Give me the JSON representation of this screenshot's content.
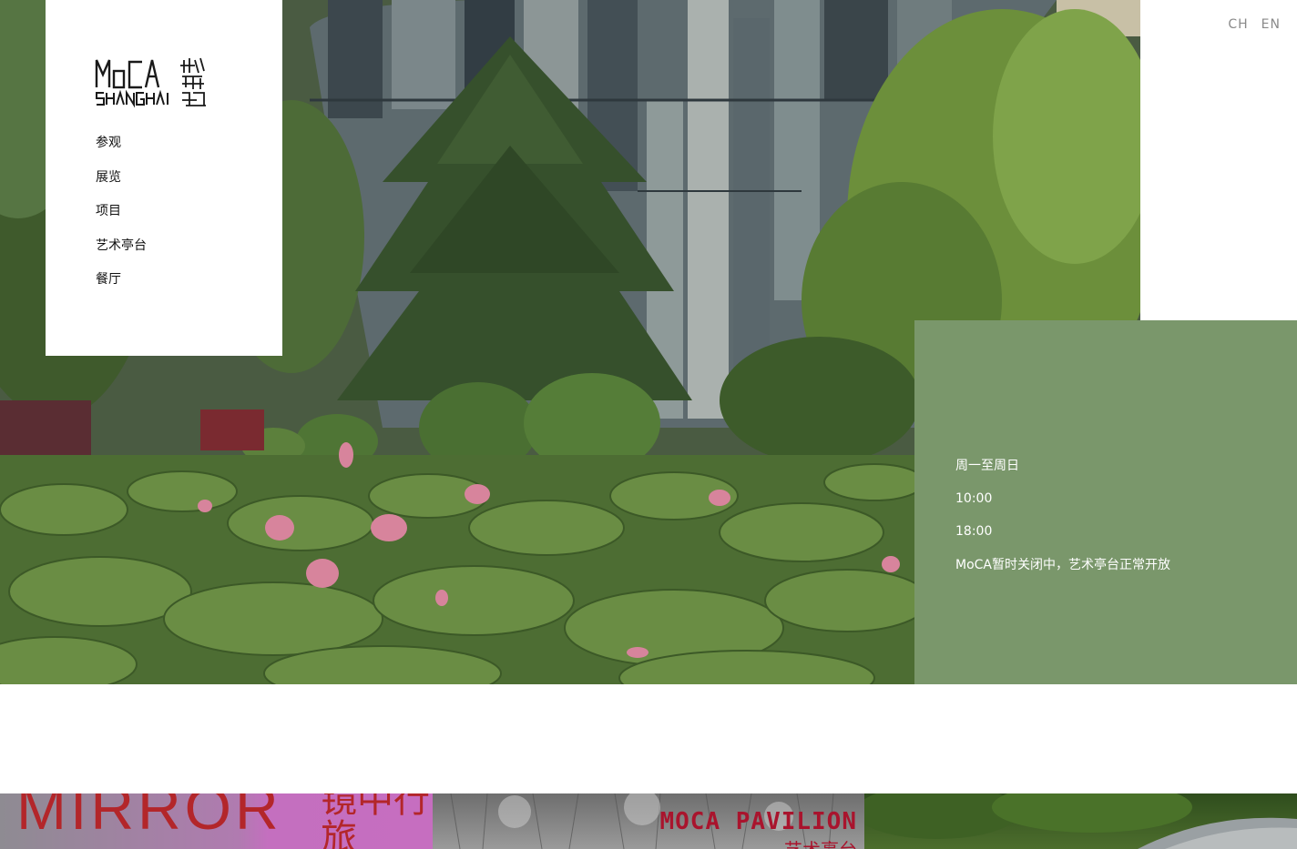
{
  "nav": {
    "logo_alt": "MoCA Shanghai",
    "items": [
      {
        "label": "参观"
      },
      {
        "label": "展览"
      },
      {
        "label": "项目"
      },
      {
        "label": "艺术亭台"
      },
      {
        "label": "餐厅"
      }
    ]
  },
  "lang": {
    "ch": "CH",
    "en": "EN"
  },
  "info": {
    "days": "周一至周日",
    "open": "10:00",
    "close": "18:00",
    "notice": "MoCA暂时关闭中，艺术亭台正常开放"
  },
  "strip": {
    "tile1_text": "MIRROR",
    "tile1_cn": "镜中行旅",
    "tile2_text": "MOCA PAVILION",
    "tile2_cn": "艺术亭台"
  },
  "colors": {
    "info_bg": "#7a976b",
    "lang_text": "#8a8a8a",
    "accent_red": "#b3262a"
  },
  "icons": {
    "logo": "moca-shanghai-logo"
  }
}
